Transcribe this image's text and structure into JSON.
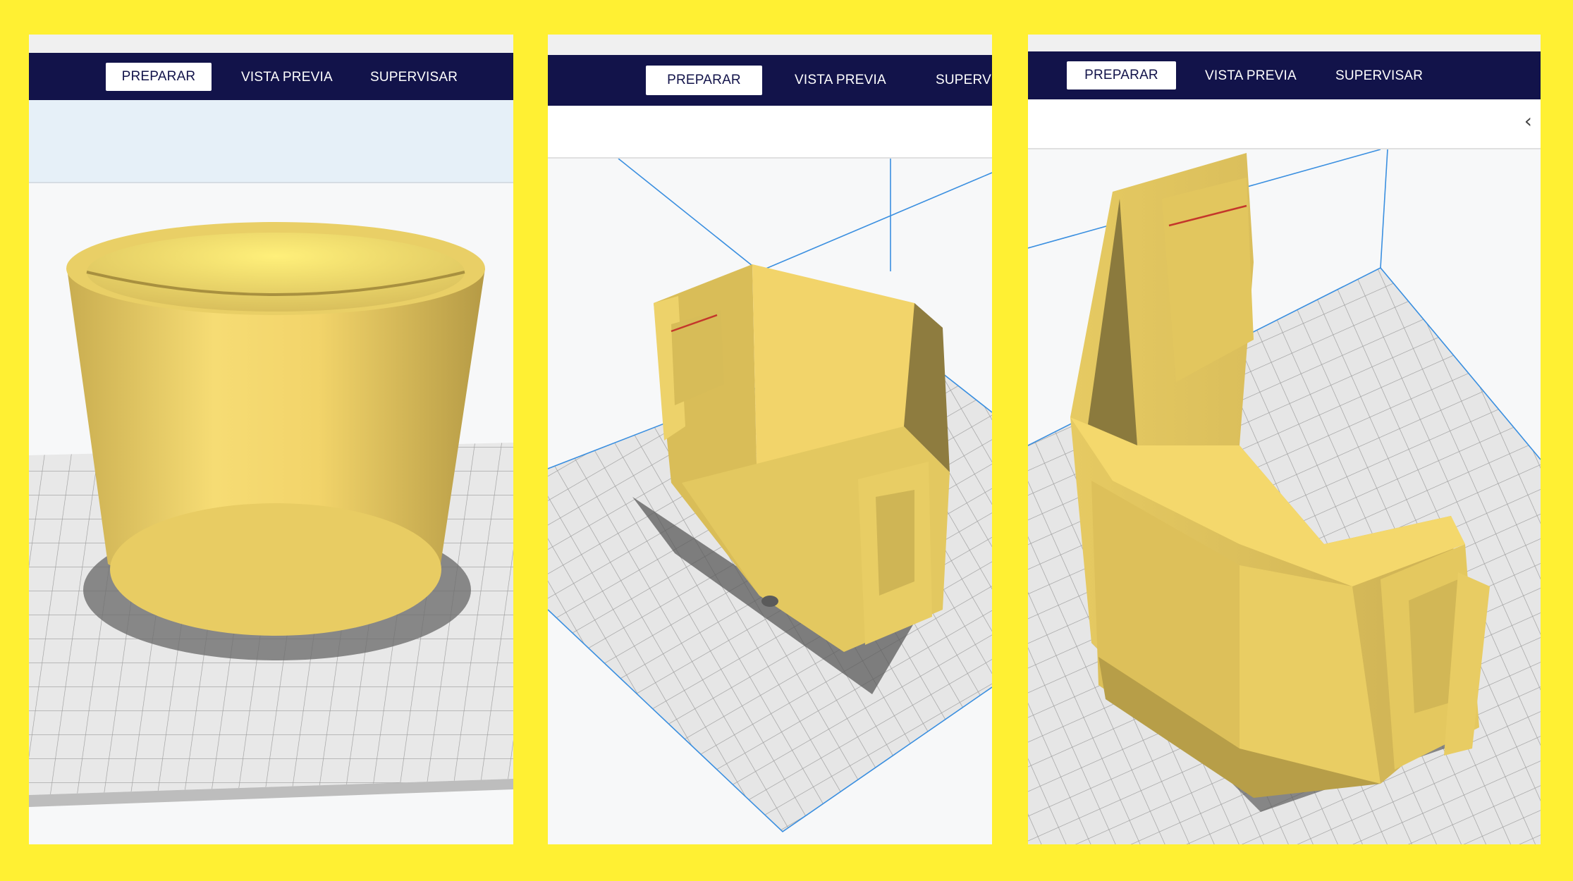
{
  "tabs": {
    "prepare": "PREPARAR",
    "preview": "VISTA PREVIA",
    "monitor": "SUPERVISAR"
  },
  "panels": [
    {
      "id": "left",
      "model": "cylindrical-cup"
    },
    {
      "id": "middle",
      "model": "pentagonal-holder"
    },
    {
      "id": "right",
      "model": "holder-rotated-view"
    }
  ],
  "icons": {
    "collapse": "‹"
  },
  "colors": {
    "frame": "#fff033",
    "navbar": "#12134a",
    "model": "#f2d46a",
    "buildplate": "#e6e6e6",
    "volume_lines": "#3a8fe0"
  }
}
